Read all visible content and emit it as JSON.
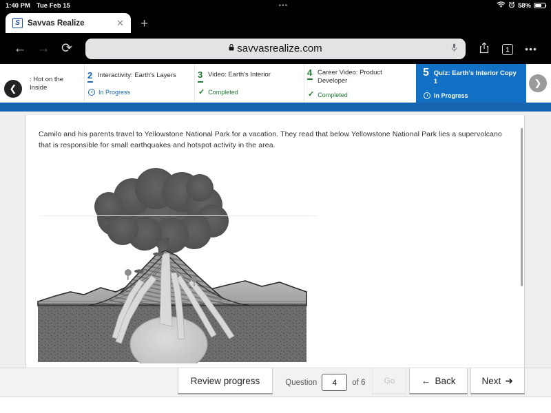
{
  "status_bar": {
    "time": "1:40 PM",
    "date": "Tue Feb 15",
    "center_dots": "•••",
    "wifi_icon": "wifi-icon",
    "alarm_icon": "alarm-icon",
    "battery_percent": "58%",
    "battery_level": 58
  },
  "browser": {
    "tab": {
      "title": "Savvas Realize",
      "favicon_letter": "S",
      "close_label": "✕"
    },
    "new_tab_label": "+",
    "back_icon": "←",
    "forward_icon": "→",
    "reload_icon": "⟳",
    "url": "savvasrealize.com",
    "lock_icon": "🔒",
    "mic_icon": "microphone-icon",
    "share_icon": "⇪",
    "tab_count": "1",
    "more_icon": "•••"
  },
  "lesson_nav": {
    "prev_arrow": "❮",
    "next_arrow": "❯",
    "steps": [
      {
        "number": "",
        "title": ": Hot on the Inside",
        "status": "",
        "status_type": "none"
      },
      {
        "number": "2",
        "title": "Interactivity: Earth's Layers",
        "status": "In Progress",
        "status_type": "inprogress"
      },
      {
        "number": "3",
        "title": "Video: Earth's Interior",
        "status": "Completed",
        "status_type": "completed"
      },
      {
        "number": "4",
        "title": "Career Video: Product Developer",
        "status": "Completed",
        "status_type": "completed"
      },
      {
        "number": "5",
        "title": "Quiz: Earth's Interior Copy 1",
        "status": "In Progress",
        "status_type": "inprogress",
        "active": true
      }
    ]
  },
  "quiz": {
    "question_text": "Camilo and his parents travel to Yellowstone National Park for a vacation. They read that below Yellowstone National Park lies a supervolcano that is responsible for small earthquakes and hotspot activity in the area.",
    "figure_alt": "volcano-cross-section-diagram"
  },
  "bottom_bar": {
    "review_progress_label": "Review progress",
    "question_label": "Question",
    "question_number": "4",
    "of_label": "of 6",
    "go_label": "Go",
    "back_label": "Back",
    "back_icon": "←",
    "next_label": "Next",
    "next_icon": "➜"
  },
  "colors": {
    "accent_blue": "#1271c4",
    "band_blue": "#1564ad",
    "completed_green": "#1f7a30",
    "inprogress_blue": "#1a66b5"
  }
}
